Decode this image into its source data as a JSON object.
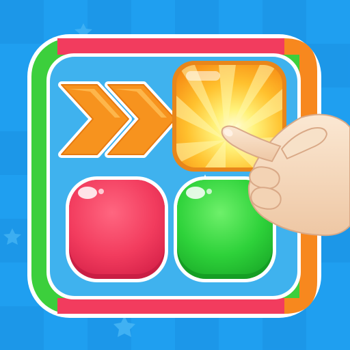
{
  "app_icon": {
    "name": "color-tap-puzzle-icon",
    "colors": {
      "background": "#1f9ff0",
      "background_dark": "#1386d8",
      "board_fill": "#3fb2ee",
      "frame_green": "#3ccf3c",
      "frame_red": "#f23c5e",
      "frame_orange": "#f7881e",
      "arrow_orange": "#f7931e",
      "tile_orange": "#ffa21f",
      "tile_glow": "#fff27a",
      "tile_red": "#f23c5e",
      "tile_green": "#2ed23a",
      "hand_skin": "#f6dcc0",
      "outline_white": "#ffffff"
    },
    "icons": [
      "double-chevron-right-icon",
      "glowing-orange-tile-icon",
      "red-tile-icon",
      "green-tile-icon",
      "pointing-hand-icon",
      "star-icon"
    ],
    "tiles": [
      {
        "id": "orange",
        "state": "tapped"
      },
      {
        "id": "red",
        "state": "idle"
      },
      {
        "id": "green",
        "state": "idle"
      }
    ]
  }
}
